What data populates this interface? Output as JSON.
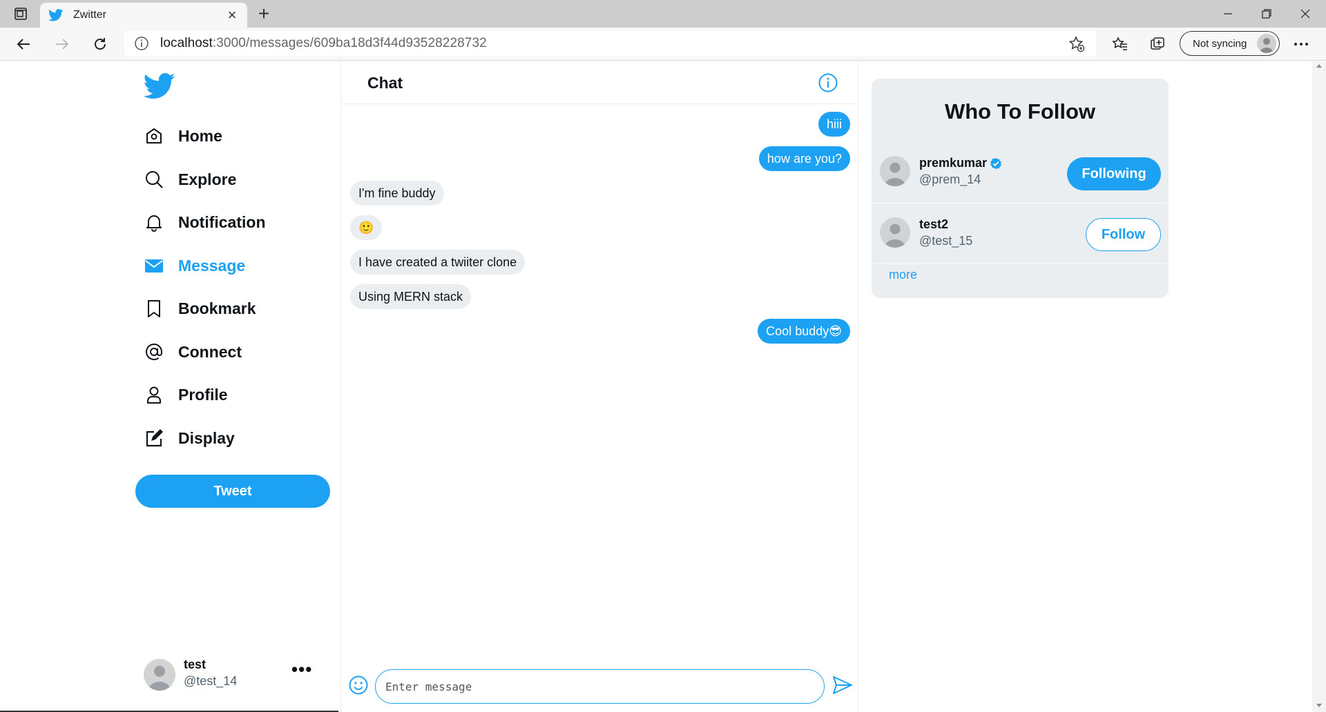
{
  "browser": {
    "tab_title": "Zwitter",
    "url_host": "localhost",
    "url_rest": ":3000/messages/609ba18d3f44d93528228732",
    "sync_label": "Not syncing",
    "accent": "#1da1f2"
  },
  "sidebar": {
    "items": [
      {
        "label": "Home",
        "icon": "home-icon"
      },
      {
        "label": "Explore",
        "icon": "search-icon"
      },
      {
        "label": "Notification",
        "icon": "bell-icon"
      },
      {
        "label": "Message",
        "icon": "mail-icon",
        "active": true
      },
      {
        "label": "Bookmark",
        "icon": "bookmark-icon"
      },
      {
        "label": "Connect",
        "icon": "at-icon"
      },
      {
        "label": "Profile",
        "icon": "user-icon"
      },
      {
        "label": "Display",
        "icon": "edit-icon"
      }
    ],
    "tweet_label": "Tweet",
    "me": {
      "name": "test",
      "handle": "@test_14",
      "more": "•••"
    }
  },
  "chat": {
    "title": "Chat",
    "messages": [
      {
        "text": "hiii",
        "dir": "out"
      },
      {
        "text": "how are you?",
        "dir": "out"
      },
      {
        "text": "I'm fine buddy",
        "dir": "in"
      },
      {
        "text": "🙂",
        "dir": "in"
      },
      {
        "text": "I have created a twiiter clone",
        "dir": "in"
      },
      {
        "text": "Using MERN stack",
        "dir": "in"
      },
      {
        "text": "Cool buddy😎",
        "dir": "out"
      }
    ],
    "input_placeholder": "Enter message"
  },
  "who_to_follow": {
    "title": "Who To Follow",
    "users": [
      {
        "name": "premkumar",
        "handle": "@prem_14",
        "verified": true,
        "button": "Following"
      },
      {
        "name": "test2",
        "handle": "@test_15",
        "verified": false,
        "button": "Follow"
      }
    ],
    "more": "more"
  }
}
